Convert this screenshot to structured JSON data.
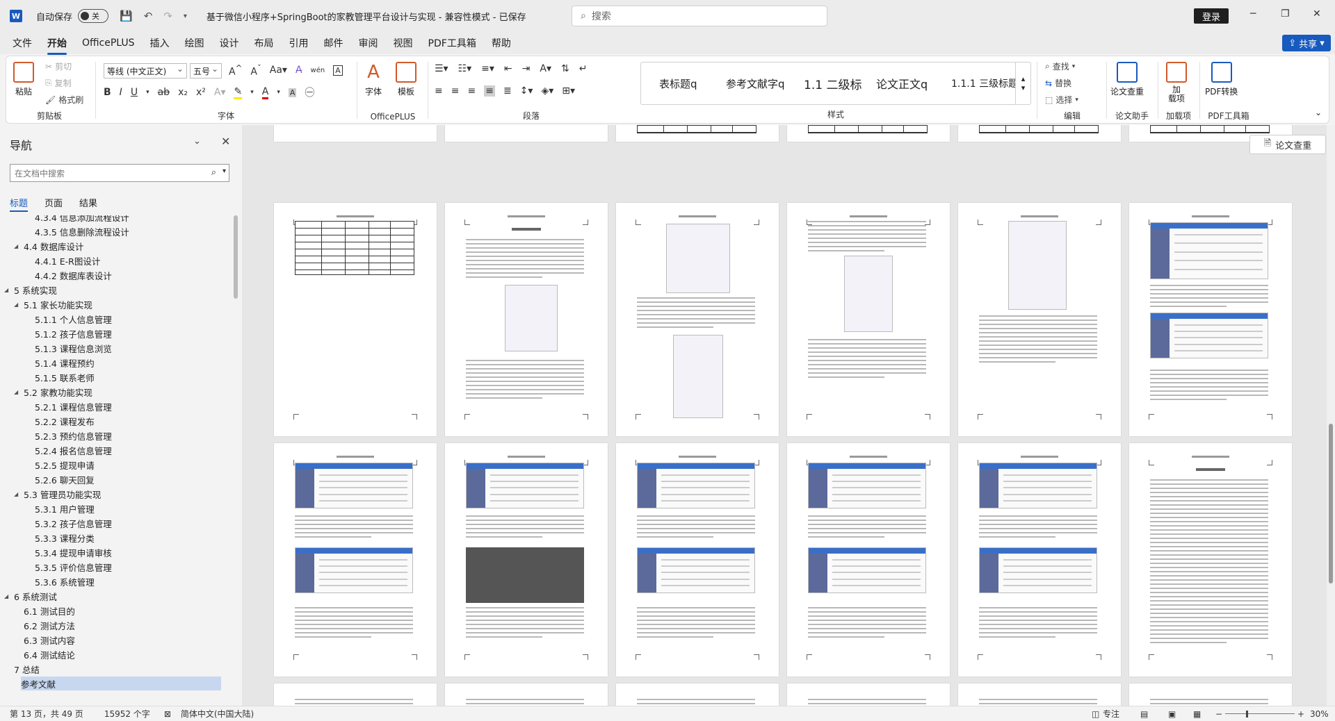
{
  "titlebar": {
    "app_logo": "W",
    "autosave_label": "自动保存",
    "autosave_state": "关",
    "doc_title": "基于微信小程序+SpringBoot的家教管理平台设计与实现 - 兼容性模式 - 已保存",
    "search_placeholder": "搜索",
    "login_label": "登录"
  },
  "menu": {
    "items": [
      "文件",
      "开始",
      "OfficePLUS",
      "插入",
      "绘图",
      "设计",
      "布局",
      "引用",
      "邮件",
      "审阅",
      "视图",
      "PDF工具箱",
      "帮助"
    ],
    "share_label": "共享"
  },
  "ribbon": {
    "clipboard": {
      "paste": "粘贴",
      "cut": "剪切",
      "copy": "复制",
      "format_painter": "格式刷",
      "label": "剪贴板"
    },
    "font": {
      "family": "等线 (中文正文)",
      "size": "五号",
      "label": "字体"
    },
    "officeplus": {
      "font_btn": "字体",
      "template_btn": "模板",
      "label": "OfficePLUS"
    },
    "paragraph": {
      "label": "段落"
    },
    "styles": {
      "items": [
        "表标题q",
        "参考文献字q",
        "1.1  二级标",
        "论文正文q",
        "1.1.1  三级标题"
      ],
      "label": "样式"
    },
    "editing": {
      "find": "查找",
      "replace": "替换",
      "select": "选择",
      "label": "编辑"
    },
    "paper_assist": {
      "check": "论文查重",
      "label": "论文助手"
    },
    "page_add": {
      "btn": "加\n载项",
      "label": "加载项"
    },
    "pdf": {
      "btn": "PDF转换",
      "label": "PDF工具箱"
    }
  },
  "nav": {
    "title": "导航",
    "search_placeholder": "在文档中搜索",
    "tabs": [
      "标题",
      "页面",
      "结果"
    ],
    "items": [
      {
        "level": 3,
        "text": "4.3.4 信息添加流程设计",
        "tri": false
      },
      {
        "level": 3,
        "text": "4.3.5 信息删除流程设计",
        "tri": false
      },
      {
        "level": 2,
        "text": "4.4 数据库设计",
        "tri": true
      },
      {
        "level": 3,
        "text": "4.4.1 E-R图设计",
        "tri": false
      },
      {
        "level": 3,
        "text": "4.4.2 数据库表设计",
        "tri": false
      },
      {
        "level": 1,
        "text": "5 系统实现",
        "tri": true
      },
      {
        "level": 2,
        "text": "5.1 家长功能实现",
        "tri": true
      },
      {
        "level": 3,
        "text": "5.1.1 个人信息管理",
        "tri": false
      },
      {
        "level": 3,
        "text": "5.1.2 孩子信息管理",
        "tri": false
      },
      {
        "level": 3,
        "text": "5.1.3 课程信息浏览",
        "tri": false
      },
      {
        "level": 3,
        "text": "5.1.4 课程预约",
        "tri": false
      },
      {
        "level": 3,
        "text": "5.1.5 联系老师",
        "tri": false
      },
      {
        "level": 2,
        "text": "5.2 家教功能实现",
        "tri": true
      },
      {
        "level": 3,
        "text": "5.2.1 课程信息管理",
        "tri": false
      },
      {
        "level": 3,
        "text": "5.2.2 课程发布",
        "tri": false
      },
      {
        "level": 3,
        "text": "5.2.3 预约信息管理",
        "tri": false
      },
      {
        "level": 3,
        "text": "5.2.4 报名信息管理",
        "tri": false
      },
      {
        "level": 3,
        "text": "5.2.5 提现申请",
        "tri": false
      },
      {
        "level": 3,
        "text": "5.2.6 聊天回复",
        "tri": false
      },
      {
        "level": 2,
        "text": "5.3 管理员功能实现",
        "tri": true
      },
      {
        "level": 3,
        "text": "5.3.1 用户管理",
        "tri": false
      },
      {
        "level": 3,
        "text": "5.3.2 孩子信息管理",
        "tri": false
      },
      {
        "level": 3,
        "text": "5.3.3 课程分类",
        "tri": false
      },
      {
        "level": 3,
        "text": "5.3.4 提现申请审核",
        "tri": false
      },
      {
        "level": 3,
        "text": "5.3.5 评价信息管理",
        "tri": false
      },
      {
        "level": 3,
        "text": "5.3.6 系统管理",
        "tri": false
      },
      {
        "level": 1,
        "text": "6 系统测试",
        "tri": true
      },
      {
        "level": 2,
        "text": "6.1 测试目的",
        "tri": false
      },
      {
        "level": 2,
        "text": "6.2 测试方法",
        "tri": false
      },
      {
        "level": 2,
        "text": "6.3 测试内容",
        "tri": false
      },
      {
        "level": 2,
        "text": "6.4 测试结论",
        "tri": false
      },
      {
        "level": 1,
        "text": "7 总结",
        "tri": false
      },
      {
        "level": 1,
        "text": "参考文献",
        "tri": false,
        "selected": true
      }
    ]
  },
  "doc": {
    "side_button": "论文查重",
    "page_headings": {
      "p2_2": "5  系统实现",
      "p3_6": "6  系统测试"
    }
  },
  "status": {
    "page": "第 13 页，共 49 页",
    "words": "15952 个字",
    "lang": "简体中文(中国大陆)",
    "focus": "专注",
    "zoom": "30%"
  }
}
